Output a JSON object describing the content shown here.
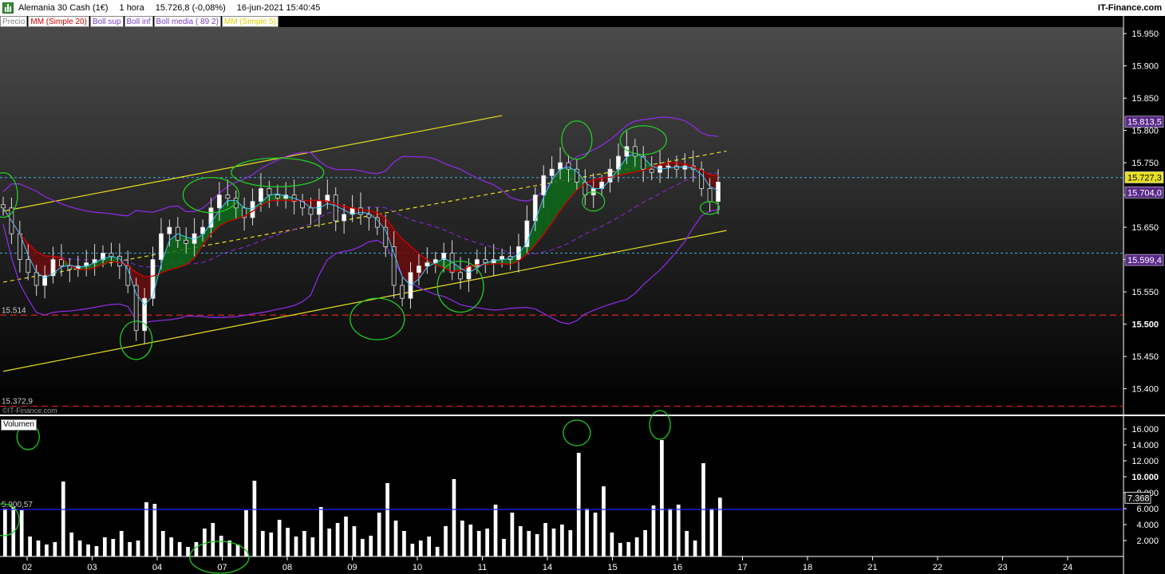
{
  "header": {
    "instrument": "Alemania 30 Cash (1€)",
    "timeframe": "1 hora",
    "last": "15.726,8 (-0,08%)",
    "datetime": "16-jun-2021 15:40:45",
    "brand": "IT-Finance.com"
  },
  "legend": [
    {
      "label": "Precio",
      "color": "#888888"
    },
    {
      "label": "MM (Simple 20)",
      "color": "#cc0000"
    },
    {
      "label": "Boll sup",
      "color": "#7a3ec8"
    },
    {
      "label": "Boll inf",
      "color": "#7a3ec8"
    },
    {
      "label": "Boll media ( 89 2)",
      "color": "#7a3ec8"
    },
    {
      "label": "MM (Simple 5)",
      "color": "#e0d000"
    }
  ],
  "copyright": "©IT-Finance.com",
  "volume_label": "Volumen",
  "colors": {
    "background": "#000000",
    "sma20": "#cc0000",
    "bollinger": "#8a2be2",
    "channel": "#e8e020",
    "support_dashed": "#dd2222",
    "horizontal_cyan": "#3aaee0",
    "annotation_circle": "#22cc22",
    "volume_avg": "#2222ff"
  },
  "chart_data": [
    {
      "type": "candlestick",
      "title": "Alemania 30 Cash (1€)",
      "x_tick_labels": [
        "02",
        "03",
        "04",
        "07",
        "08",
        "09",
        "10",
        "11",
        "14",
        "15",
        "16",
        "17",
        "18",
        "21",
        "22",
        "23",
        "24"
      ],
      "y_tick_labels": [
        "15.950",
        "15.900",
        "15.850",
        "15.800",
        "15.750",
        "15.700",
        "15.650",
        "15.600",
        "15.550",
        "15.500",
        "15.450",
        "15.400"
      ],
      "ylim": [
        15360,
        15960
      ],
      "y_ticks": [
        15950,
        15900,
        15850,
        15800,
        15750,
        15700,
        15650,
        15600,
        15550,
        15500,
        15450,
        15400
      ],
      "price_levels": [
        {
          "label": "15.514",
          "value": 15514,
          "style": "red-dashed"
        },
        {
          "label": "15.372,9",
          "value": 15372.9,
          "style": "red-dashed"
        },
        {
          "value": 15610,
          "style": "cyan-dotted"
        },
        {
          "value": 15727,
          "style": "cyan-dotted"
        }
      ],
      "right_tags": [
        {
          "label": "15.727,3",
          "value": 15727.3,
          "bg": "#e8e020",
          "fg": "#000000"
        },
        {
          "label": "15.599,4",
          "value": 15599.4,
          "bg": "#5a2a8a",
          "fg": "#ffffff"
        },
        {
          "label": "15.704,0",
          "value": 15704.0,
          "bg": "#5a2a8a",
          "fg": "#ffffff"
        },
        {
          "label": "15.813,5",
          "value": 15813.5,
          "bg": "#5a2a8a",
          "fg": "#ffffff"
        }
      ],
      "price_path": [
        [
          0,
          15680
        ],
        [
          1,
          15640
        ],
        [
          2,
          15600
        ],
        [
          3,
          15580
        ],
        [
          4,
          15560
        ],
        [
          5,
          15575
        ],
        [
          6,
          15600
        ],
        [
          7,
          15590
        ],
        [
          8,
          15585
        ],
        [
          9,
          15590
        ],
        [
          10,
          15595
        ],
        [
          11,
          15600
        ],
        [
          12,
          15610
        ],
        [
          13,
          15605
        ],
        [
          14,
          15590
        ],
        [
          15,
          15560
        ],
        [
          16,
          15490
        ],
        [
          17,
          15540
        ],
        [
          18,
          15600
        ],
        [
          19,
          15640
        ],
        [
          20,
          15650
        ],
        [
          21,
          15630
        ],
        [
          22,
          15625
        ],
        [
          23,
          15640
        ],
        [
          24,
          15650
        ],
        [
          25,
          15680
        ],
        [
          26,
          15700
        ],
        [
          27,
          15695
        ],
        [
          28,
          15680
        ],
        [
          29,
          15665
        ],
        [
          30,
          15690
        ],
        [
          31,
          15710
        ],
        [
          32,
          15700
        ],
        [
          33,
          15695
        ],
        [
          34,
          15700
        ],
        [
          35,
          15690
        ],
        [
          36,
          15680
        ],
        [
          37,
          15670
        ],
        [
          38,
          15690
        ],
        [
          39,
          15700
        ],
        [
          40,
          15660
        ],
        [
          41,
          15670
        ],
        [
          42,
          15680
        ],
        [
          43,
          15670
        ],
        [
          44,
          15665
        ],
        [
          45,
          15650
        ],
        [
          46,
          15620
        ],
        [
          47,
          15560
        ],
        [
          48,
          15540
        ],
        [
          49,
          15580
        ],
        [
          50,
          15590
        ],
        [
          51,
          15595
        ],
        [
          52,
          15600
        ],
        [
          53,
          15610
        ],
        [
          54,
          15580
        ],
        [
          55,
          15570
        ],
        [
          56,
          15590
        ],
        [
          57,
          15600
        ],
        [
          58,
          15595
        ],
        [
          59,
          15600
        ],
        [
          60,
          15605
        ],
        [
          61,
          15600
        ],
        [
          62,
          15620
        ],
        [
          63,
          15660
        ],
        [
          64,
          15700
        ],
        [
          65,
          15730
        ],
        [
          66,
          15740
        ],
        [
          67,
          15750
        ],
        [
          68,
          15740
        ],
        [
          69,
          15720
        ],
        [
          70,
          15700
        ],
        [
          71,
          15710
        ],
        [
          72,
          15720
        ],
        [
          73,
          15740
        ],
        [
          74,
          15760
        ],
        [
          75,
          15775
        ],
        [
          76,
          15760
        ],
        [
          77,
          15740
        ],
        [
          78,
          15735
        ],
        [
          79,
          15745
        ],
        [
          80,
          15745
        ],
        [
          81,
          15740
        ],
        [
          82,
          15745
        ],
        [
          83,
          15740
        ],
        [
          84,
          15710
        ],
        [
          85,
          15690
        ],
        [
          86,
          15720
        ]
      ],
      "bars_total": 86,
      "channel_lines": [
        {
          "from": [
            0,
            15675
          ],
          "to": [
            60,
            15823
          ],
          "style": "solid"
        },
        {
          "from": [
            0,
            15427
          ],
          "to": [
            87,
            15645
          ],
          "style": "solid"
        },
        {
          "from": [
            0,
            15565
          ],
          "to": [
            87,
            15768
          ],
          "style": "dashed"
        }
      ],
      "volume": {
        "label": "Volumen",
        "y_tick_labels": [
          "16.000",
          "14.000",
          "12.000",
          "10.000",
          "8.000",
          "6.000",
          "4.000",
          "2.000"
        ],
        "y_ticks": [
          16000,
          14000,
          12000,
          10000,
          8000,
          6000,
          4000,
          2000
        ],
        "ylim": [
          0,
          17000
        ],
        "average_label": "5.900,57",
        "average": 5900.57,
        "last_label": "7.368",
        "last": 7368,
        "values": [
          6000,
          6200,
          5800,
          2500,
          2000,
          1500,
          1800,
          9400,
          3000,
          2000,
          1500,
          1300,
          2400,
          2200,
          3200,
          1800,
          2000,
          6800,
          6600,
          3200,
          2400,
          1800,
          1200,
          1800,
          3500,
          4200,
          2600,
          2000,
          1500,
          5800,
          9500,
          3200,
          3000,
          4600,
          3600,
          2500,
          3200,
          2400,
          6200,
          3500,
          4200,
          5000,
          3800,
          2200,
          2600,
          5500,
          9200,
          4500,
          3200,
          1600,
          2000,
          2500,
          1200,
          3800,
          9700,
          4500,
          4000,
          3200,
          3500,
          6500,
          2200,
          5500,
          3800,
          3200,
          2800,
          4200,
          3500,
          4000,
          3300,
          13000,
          6000,
          5500,
          8800,
          3000,
          1700,
          1800,
          2400,
          3300,
          6400,
          14600,
          6000,
          6500,
          3200,
          2000,
          11700,
          6000,
          7368
        ]
      }
    }
  ]
}
